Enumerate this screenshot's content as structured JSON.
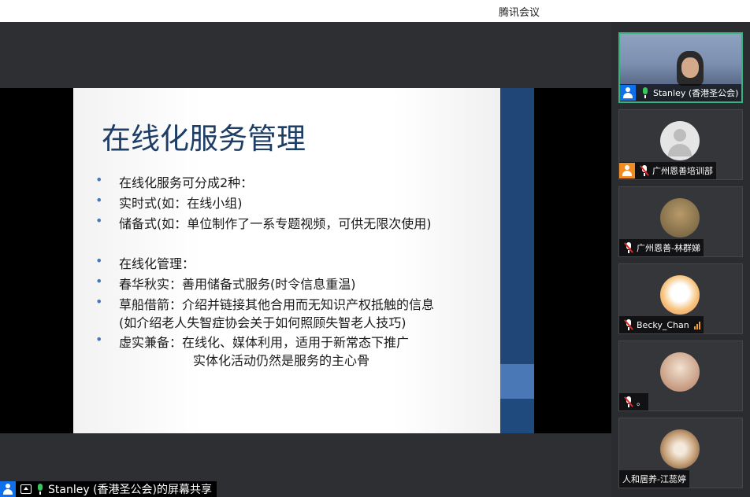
{
  "window": {
    "title": "腾讯会议"
  },
  "slide": {
    "title": "在线化服务管理",
    "bullets": [
      {
        "text": "在线化服务可分成2种："
      },
      {
        "text": "实时式(如：在线小组)"
      },
      {
        "text": "储备式(如：单位制作了一系专题视频，可供无限次使用)"
      },
      {
        "text": "在线化管理："
      },
      {
        "text": "春华秋实：善用储备式服务(时令信息重温)"
      },
      {
        "text": "草船借箭：介绍并链接其他合用而无知识产权抵触的信息"
      },
      {
        "text": "(如介绍老人失智症协会关于如何照顾失智老人技巧)"
      },
      {
        "text": "虚实兼备：在线化、媒体利用，适用于新常态下推广"
      },
      {
        "text": "实体化活动仍然是服务的主心骨"
      }
    ]
  },
  "participants": [
    {
      "name": "Stanley (香港圣公会)",
      "mic": "on",
      "video": true,
      "icon": "person-icon",
      "active": true
    },
    {
      "name": "广州恩善培训部",
      "mic": "muted",
      "video": false,
      "icon": "person-icon",
      "avatar": "default"
    },
    {
      "name": "广州恩善-林群娣",
      "mic": "muted",
      "video": false,
      "avatar": "photo"
    },
    {
      "name": "Becky_Chan",
      "mic": "muted",
      "video": false,
      "avatar": "photo",
      "signal": "signal-bars-icon"
    },
    {
      "name": "。",
      "mic": "muted",
      "video": false,
      "avatar": "photo"
    },
    {
      "name": "人和居养-江蕊婷",
      "mic": "none",
      "video": false,
      "avatar": "photo"
    }
  ],
  "status": {
    "share_text": "Stanley (香港圣公会)的屏幕共享"
  },
  "colors": {
    "accent": "#0e71eb",
    "active_border": "#36b37e",
    "slide_title": "#1e3e66",
    "slide_band": "#1f4677"
  }
}
